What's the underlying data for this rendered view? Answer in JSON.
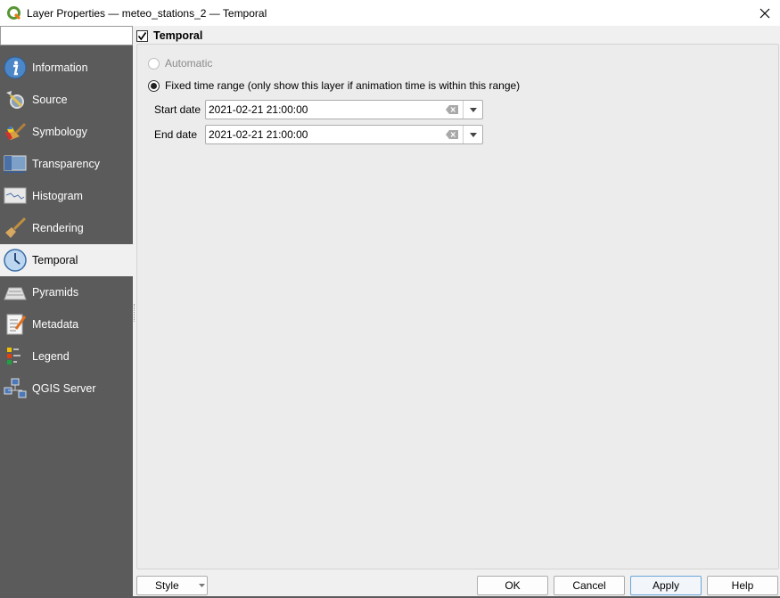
{
  "window": {
    "title": "Layer Properties — meteo_stations_2 — Temporal",
    "app_icon": "qgis-logo-icon",
    "close_icon": "close-icon"
  },
  "sidebar": {
    "search": {
      "value": "",
      "placeholder": "",
      "icon": "search-icon"
    },
    "items": [
      {
        "label": "Information",
        "icon": "information-icon"
      },
      {
        "label": "Source",
        "icon": "source-settings-icon"
      },
      {
        "label": "Symbology",
        "icon": "symbology-paintbrush-icon"
      },
      {
        "label": "Transparency",
        "icon": "transparency-icon"
      },
      {
        "label": "Histogram",
        "icon": "histogram-icon"
      },
      {
        "label": "Rendering",
        "icon": "rendering-brush-icon"
      },
      {
        "label": "Temporal",
        "icon": "clock-icon",
        "active": true
      },
      {
        "label": "Pyramids",
        "icon": "pyramids-icon"
      },
      {
        "label": "Metadata",
        "icon": "metadata-icon"
      },
      {
        "label": "Legend",
        "icon": "legend-icon"
      },
      {
        "label": "QGIS Server",
        "icon": "qgis-server-icon"
      }
    ]
  },
  "temporal": {
    "enabled_label": "Temporal",
    "enabled": true,
    "mode_automatic": {
      "label": "Automatic",
      "selected": false,
      "disabled": true
    },
    "mode_fixed": {
      "label": "Fixed time range (only show this layer if animation time is within this range)",
      "selected": true
    },
    "start_date": {
      "label": "Start date",
      "value": "2021-02-21 21:00:00"
    },
    "end_date": {
      "label": "End date",
      "value": "2021-02-21 21:00:00"
    }
  },
  "footer": {
    "style_label": "Style",
    "ok_label": "OK",
    "cancel_label": "Cancel",
    "apply_label": "Apply",
    "help_label": "Help"
  },
  "colors": {
    "sidebar_bg": "#5b5b5b",
    "active_item_bg": "#f0f0f0",
    "panel_bg": "#ececec",
    "default_button_border": "#6aa5d8"
  }
}
